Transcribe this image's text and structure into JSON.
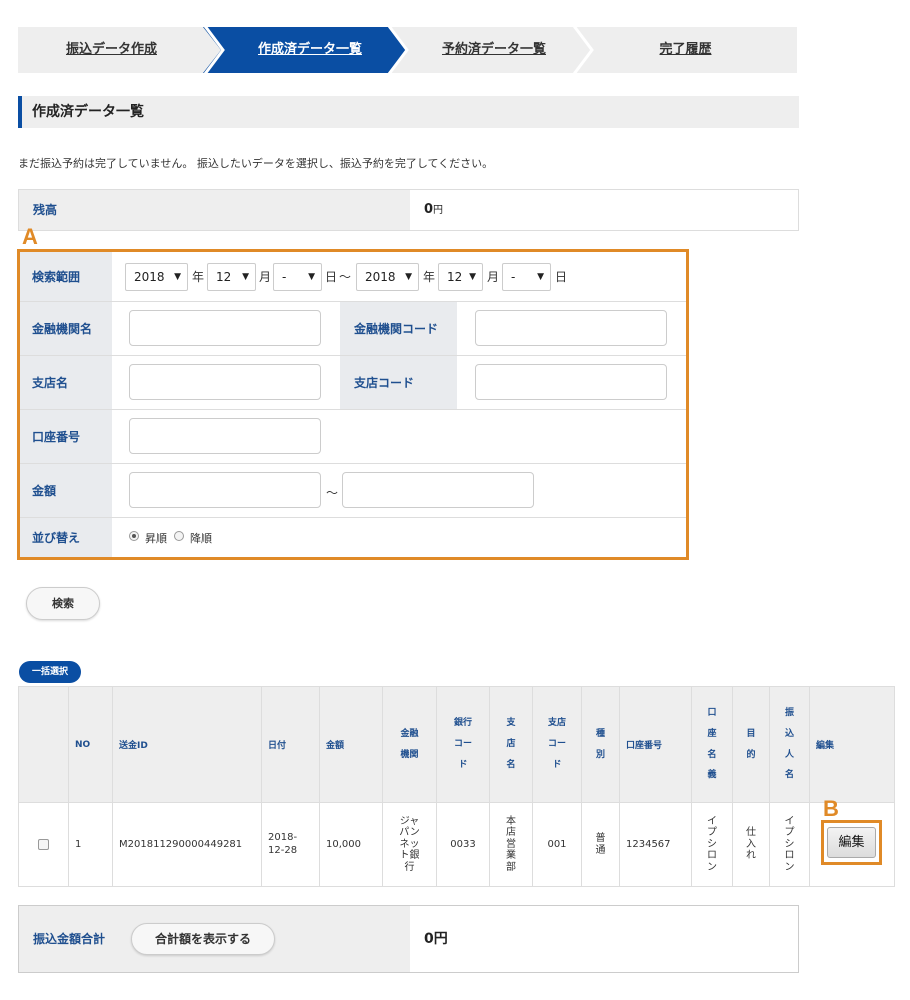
{
  "stepper": {
    "steps": [
      {
        "label": "振込データ作成"
      },
      {
        "label": "作成済データ一覧"
      },
      {
        "label": "予約済データ一覧"
      },
      {
        "label": "完了履歴"
      }
    ],
    "active_index": 1,
    "colors": {
      "active": "#0a4ea3",
      "inactive": "#eeeeee"
    }
  },
  "section": {
    "title": "作成済データ一覧"
  },
  "notice": "まだ振込予約は完了していません。 振込したいデータを選択し、振込予約を完了してください。",
  "balance": {
    "label": "残高",
    "value": "0",
    "unit": "円"
  },
  "annotations": {
    "a": "A",
    "b": "B"
  },
  "search": {
    "range_label": "検索範囲",
    "from": {
      "year": "2018",
      "month": "12",
      "day": "-"
    },
    "to": {
      "year": "2018",
      "month": "12",
      "day": "-"
    },
    "unit_year": "年",
    "unit_month": "月",
    "unit_day": "日",
    "range_sep": "～",
    "bank_name_label": "金融機関名",
    "bank_code_label": "金融機関コード",
    "branch_name_label": "支店名",
    "branch_code_label": "支店コード",
    "account_label": "口座番号",
    "amount_label": "金額",
    "amount_sep": "～",
    "sort_label": "並び替え",
    "sort_options": [
      {
        "label": "昇順",
        "selected": true
      },
      {
        "label": "降順",
        "selected": false
      }
    ],
    "button": "検索"
  },
  "select_all": "一括選択",
  "table": {
    "headers": {
      "no": "NO",
      "id": "送金ID",
      "date": "日付",
      "amount": "金額",
      "bank": "金融\n機関",
      "bank_code": "銀行\nコー\nド",
      "branch": "支\n店\n名",
      "branch_code": "支店\nコー\nド",
      "type": "種\n別",
      "account": "口座番号",
      "account_name": "口\n座\n名\n義",
      "purpose": "目\n的",
      "payer": "振\n込\n人\n名",
      "edit": "編集"
    },
    "rows": [
      {
        "no": "1",
        "id": "M201811290000449281",
        "date": "2018-\n12-28",
        "amount": "10,000",
        "bank": "ジャ\nパン\nネッ\nト銀\n行",
        "bank_code": "0033",
        "branch": "本\n店\n営\n業\n部",
        "branch_code": "001",
        "type": "普\n通",
        "account": "1234567",
        "account_name": "イ\nプ\nシ\nロ\nン",
        "purpose": "仕\n入\nれ",
        "payer": "イ\nプ\nシ\nロ\nン",
        "edit": "編集"
      }
    ]
  },
  "total": {
    "label": "振込金額合計",
    "button": "合計額を表示する",
    "value": "0円"
  }
}
